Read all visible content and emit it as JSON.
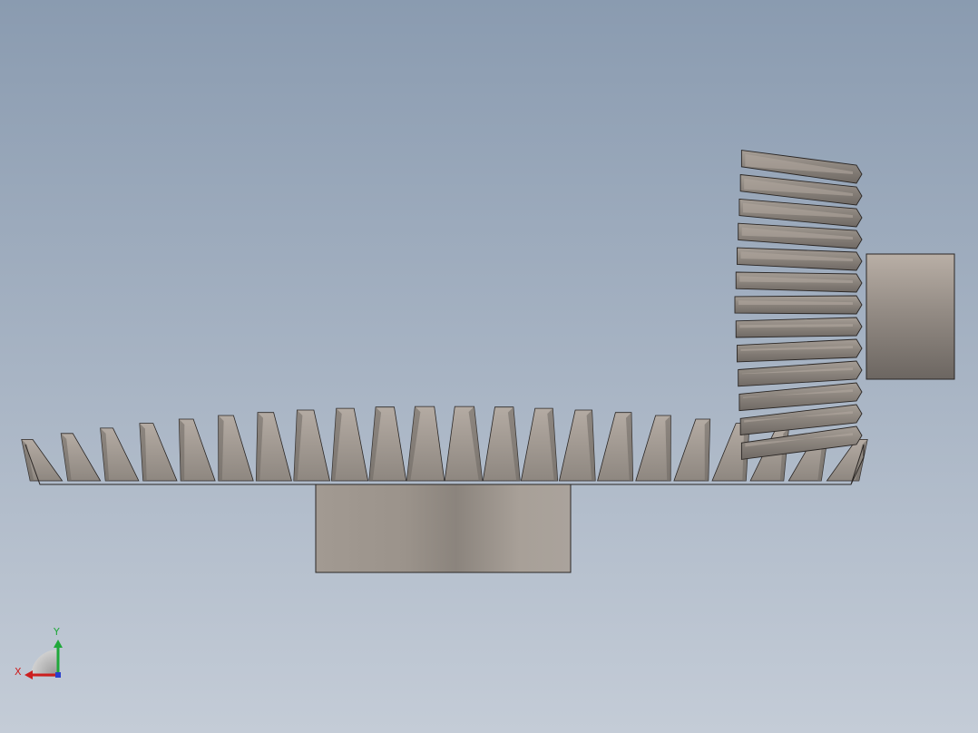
{
  "viewport": {
    "background_top": "#8a9bb0",
    "background_bottom": "#c4ccd7"
  },
  "gear": {
    "body_light": "#b0a79f",
    "body_mid": "#8f8880",
    "body_dark": "#6d6762",
    "outline": "#2a2624",
    "pinion_tooth_count": 13,
    "ring_tooth_count": 22
  },
  "triad": {
    "x_label": "X",
    "y_label": "Y",
    "x_color": "#cc1f1f",
    "y_color": "#1fa83a",
    "z_color": "#2a3fcc"
  }
}
